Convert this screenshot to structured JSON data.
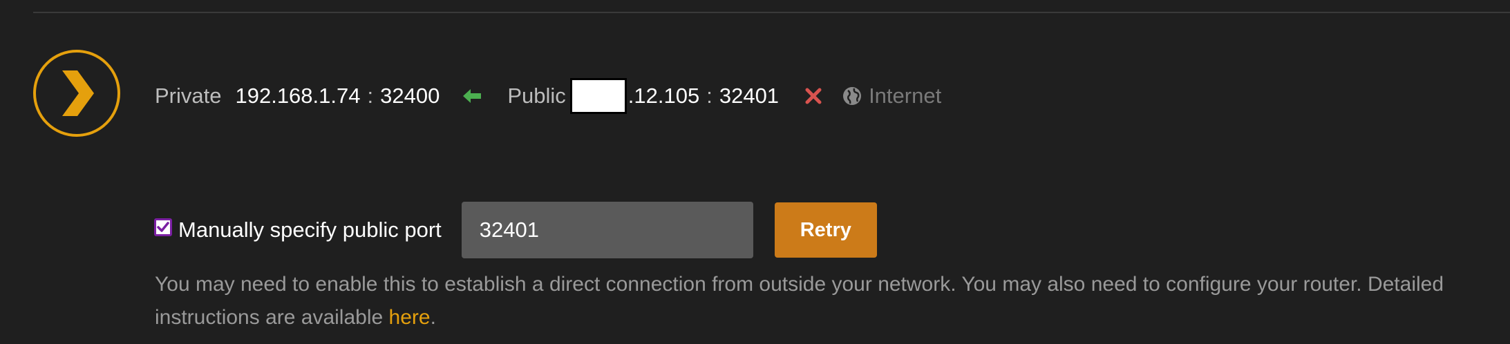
{
  "connection": {
    "private_label": "Private",
    "private_ip": "192.168.1.74",
    "private_port": "32400",
    "port_separator": ":",
    "public_label": "Public",
    "public_ip_visible_suffix": ".12.105",
    "public_port": "32401",
    "internet_label": "Internet",
    "arrow_color": "#4caf50",
    "error_color": "#d9534f"
  },
  "port_settings": {
    "checkbox_checked": true,
    "checkbox_label": "Manually specify public port",
    "port_value": "32401",
    "retry_label": "Retry"
  },
  "help": {
    "text": "You may need to enable this to establish a direct connection from outside your network. You may also need to configure your router. Detailed instructions are available ",
    "link_label": "here",
    "trailing": "."
  },
  "colors": {
    "brand": "#e5a00d",
    "button": "#cc7b19",
    "checkbox_border": "#7a1fa2"
  }
}
